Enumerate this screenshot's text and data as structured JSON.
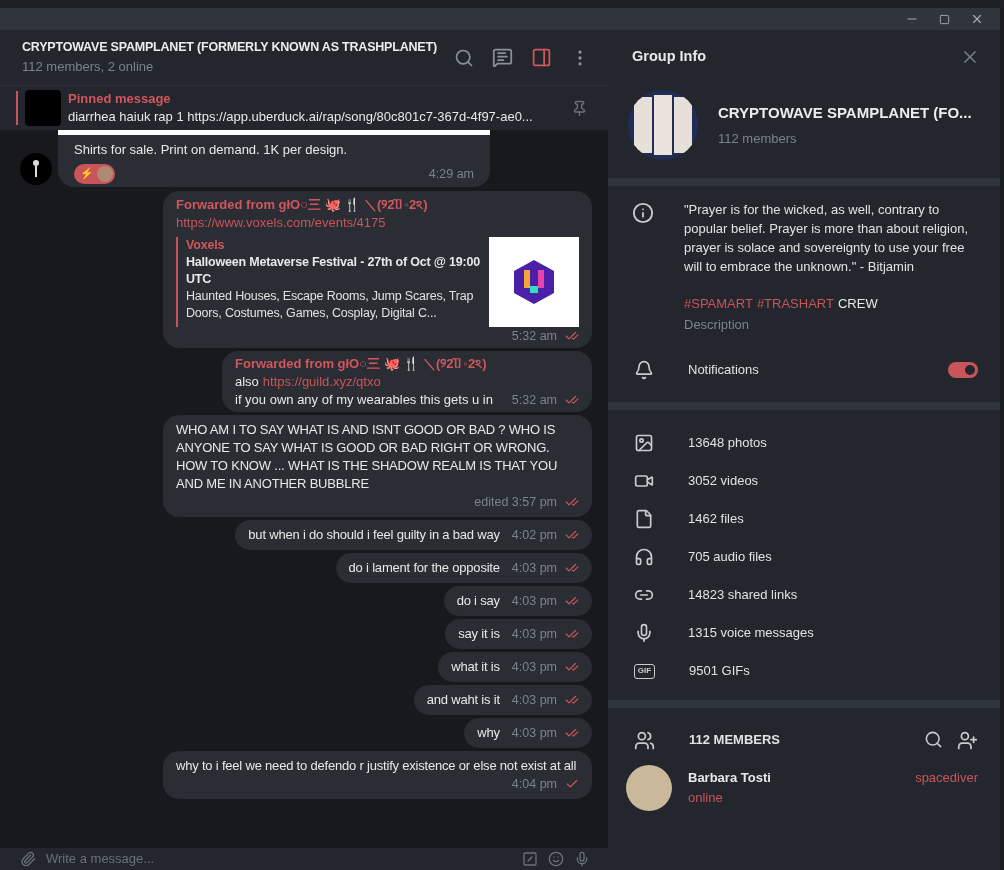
{
  "chat": {
    "title": "CRYPTOWAVE SPAMPLANET (FORMERLY KNOWN AS TRASHPLANET)",
    "subtitle": "112 members, 2 online",
    "info_toggle": {
      "selected": true
    },
    "pinned": {
      "label": "Pinned message",
      "text": "diarrhea haiuk rap 1 https://app.uberduck.ai/rap/song/80c801c7-367d-4f97-ae0..."
    },
    "messages": [
      {
        "kind": "incoming",
        "text": "Shirts for sale. Print on demand. 1K per design.",
        "reactions": [
          {
            "emoji": "⚡"
          }
        ],
        "time": "4:29 am"
      },
      {
        "kind": "forwarded_preview",
        "from": "Forwarded from ɡłO○三 🐙 🍴 ＼(୨2̂▯◦2ঽ)",
        "link": "https://www.voxels.com/events/4175",
        "preview": {
          "site": "Voxels",
          "title": "Halloween Metaverse Festival - 27th of Oct @ 19:00 UTC",
          "description": "Haunted Houses, Escape Rooms, Jump Scares, Trap Doors, Costumes, Games, Cosplay, Digital C..."
        },
        "time": "5:32 am",
        "read": true
      },
      {
        "kind": "forwarded_text",
        "from": "Forwarded from ɡłO○三 🐙 🍴 ＼(୨2̂▯◦2ঽ)",
        "lead": "also",
        "link": "https://guild.xyz/qtxo",
        "text": "if you own any of my wearables this gets u in",
        "time": "5:32 am",
        "read": true
      },
      {
        "kind": "text",
        "text": "WHO AM I TO SAY WHAT IS AND ISNT GOOD OR BAD ? WHO IS ANYONE TO SAY WHAT IS GOOD OR BAD RIGHT OR WRONG. HOW TO KNOW ... WHAT IS THE SHADOW REALM IS THAT YOU AND ME IN ANOTHER BUBBLRE",
        "time": "edited 3:57 pm",
        "read": true
      },
      {
        "kind": "text",
        "text": "but when i do should i feel guilty in a bad way",
        "time": "4:02 pm",
        "read": true
      },
      {
        "kind": "text",
        "text": "do i lament for the opposite",
        "time": "4:03 pm",
        "read": true
      },
      {
        "kind": "text",
        "text": "do i say",
        "time": "4:03 pm",
        "read": true
      },
      {
        "kind": "text",
        "text": "say it is",
        "time": "4:03 pm",
        "read": true
      },
      {
        "kind": "text",
        "text": "what it is",
        "time": "4:03 pm",
        "read": true
      },
      {
        "kind": "text",
        "text": "and waht is it",
        "time": "4:03 pm",
        "read": true
      },
      {
        "kind": "text",
        "text": "why",
        "time": "4:03 pm",
        "read": true
      },
      {
        "kind": "text",
        "text": "why to i feel we need to defendo r justify existence or else not exist at all",
        "time": "4:04 pm",
        "read": false
      }
    ],
    "composer": {
      "placeholder": "Write a message..."
    }
  },
  "info": {
    "title": "Group Info",
    "group": {
      "name": "CRYPTOWAVE SPAMPLANET (FO...",
      "members": "112 members"
    },
    "description": {
      "text": "\"Prayer is for the wicked, as well, contrary to popular belief. Prayer is more than about religion, prayer is solace and sovereignty to use your free will to embrace the unknown.\" - Bitjamin",
      "tags": [
        {
          "text": "#SPAMART",
          "kind": "hashtag"
        },
        {
          "text": "#TRASHART",
          "kind": "hashtag"
        },
        {
          "text": "CREW",
          "kind": "word"
        }
      ],
      "label": "Description"
    },
    "notifications": {
      "label": "Notifications",
      "on": true
    },
    "media": [
      {
        "kind": "photos",
        "label": "13648 photos"
      },
      {
        "kind": "videos",
        "label": "3052 videos"
      },
      {
        "kind": "files",
        "label": "1462 files"
      },
      {
        "kind": "audio",
        "label": "705 audio files"
      },
      {
        "kind": "links",
        "label": "14823 shared links"
      },
      {
        "kind": "voice",
        "label": "1315 voice messages"
      },
      {
        "kind": "gifs",
        "label": "9501 GIFs",
        "badge": "GIF"
      }
    ],
    "members": {
      "title": "112 MEMBERS",
      "list": [
        {
          "name": "Barbara Tosti",
          "status": "online",
          "online": true,
          "role": "spacediver"
        }
      ]
    }
  }
}
